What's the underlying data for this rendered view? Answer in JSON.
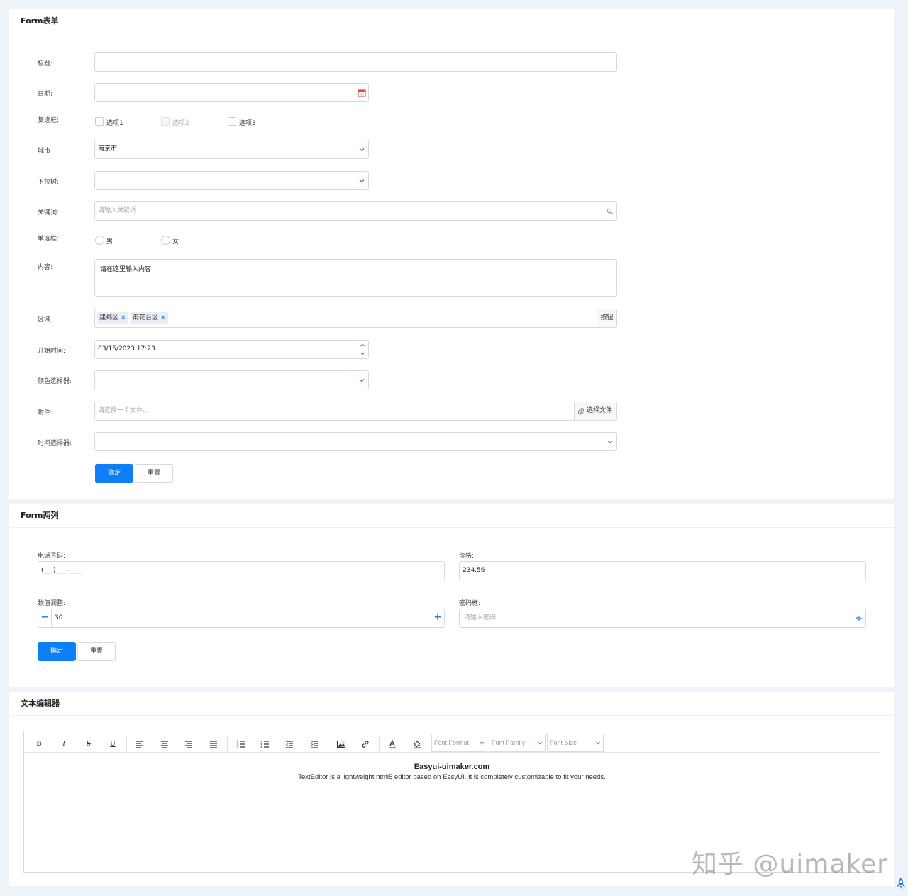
{
  "form1": {
    "title": "Form表单",
    "labels": {
      "title": "标题:",
      "date": "日期:",
      "checkbox": "复选框:",
      "city": "城市",
      "dropdown_tree": "下拉树:",
      "keyword": "关键词:",
      "radio": "单选框:",
      "content": "内容:",
      "area": "区域",
      "start_time": "开始时间:",
      "color_picker": "颜色选择器:",
      "attachment": "附件:",
      "time_picker": "时间选择器:"
    },
    "title_value": "",
    "date_value": "",
    "checkbox_options": [
      "选项1",
      "选项2",
      "选项3"
    ],
    "city_value": "南京市",
    "dropdown_tree_value": "",
    "keyword_placeholder": "请输入关键词",
    "radio_options": [
      "男",
      "女"
    ],
    "content_value": "请在这里输入内容",
    "area_tags": [
      "建邺区",
      "雨花台区"
    ],
    "area_button": "按钮",
    "start_time_value": "03/15/2023 17:23",
    "color_value": "",
    "attachment_placeholder": "请选择一个文件...",
    "attachment_button": "选择文件",
    "time_picker_value": "",
    "confirm_label": "确定",
    "reset_label": "重置"
  },
  "form2": {
    "title": "Form两列",
    "labels": {
      "phone": "电话号码:",
      "price": "价格:",
      "number": "数值调整:",
      "password": "密码框:"
    },
    "phone_value": "(___) ___-____",
    "price_value": "234.56",
    "number_value": "30",
    "password_placeholder": "请输入密码",
    "confirm_label": "确定",
    "reset_label": "重置"
  },
  "editor": {
    "title": "文本编辑器",
    "toolbar": {
      "font_format": "Font Format",
      "font_family": "Font Family",
      "font_size": "Font Size"
    },
    "content_heading": "Easyui-uimaker.com",
    "content_text": "TextEditor is a lightweight html5 editor based on EasyUI. It is completely customizable to fit your needs."
  },
  "watermark": "知乎 @uimaker",
  "colors": {
    "primary": "#0e7ef5",
    "background": "#eef2f9",
    "border": "#d6d9df"
  }
}
